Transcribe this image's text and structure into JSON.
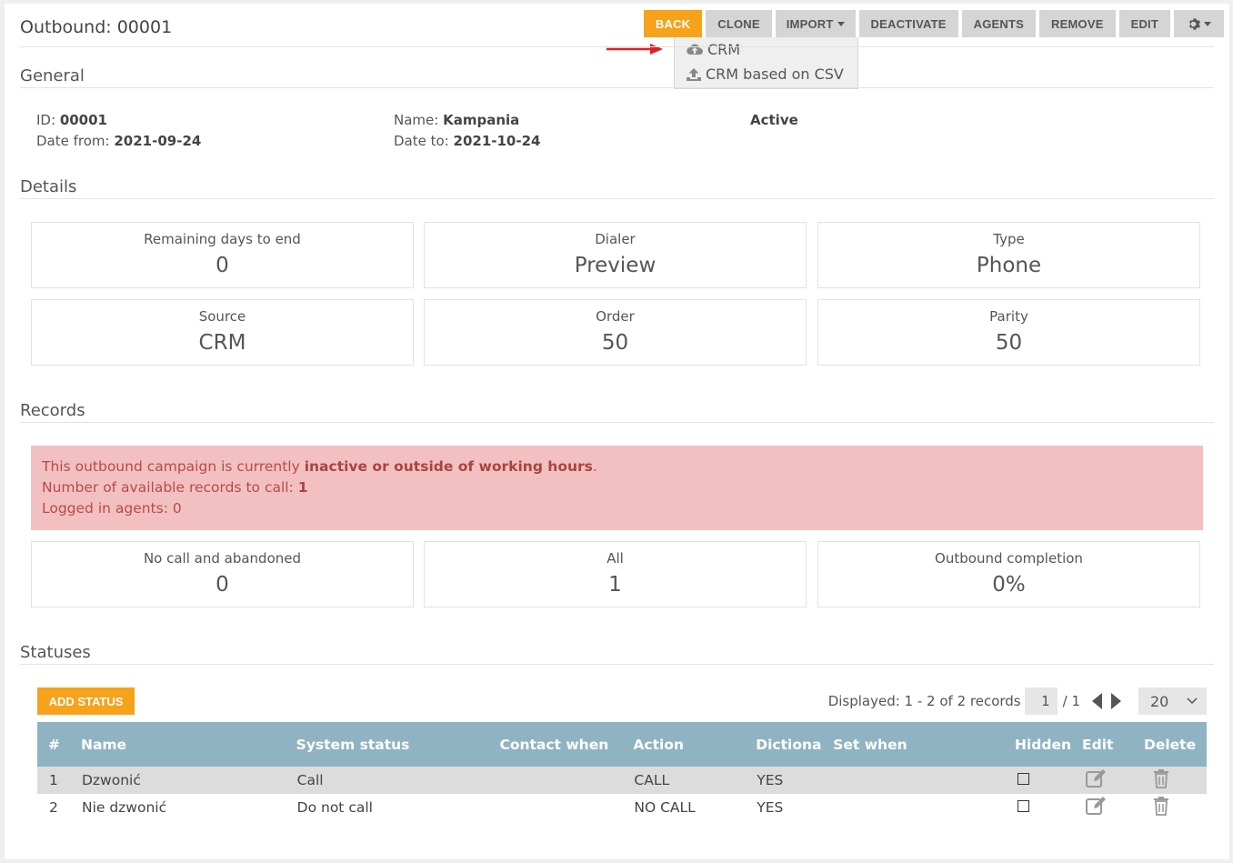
{
  "header": {
    "title": "Outbound: 00001"
  },
  "toolbar": {
    "back": "BACK",
    "clone": "CLONE",
    "import": "IMPORT",
    "deactivate": "DEACTIVATE",
    "agents": "AGENTS",
    "remove": "REMOVE",
    "edit": "EDIT"
  },
  "import_menu": {
    "crm": "CRM",
    "crm_csv": "CRM based on CSV"
  },
  "sections": {
    "general": "General",
    "details": "Details",
    "records": "Records",
    "statuses": "Statuses"
  },
  "general": {
    "id_label": "ID:",
    "id": "00001",
    "date_from_label": "Date from:",
    "date_from": "2021-09-24",
    "name_label": "Name:",
    "name": "Kampania",
    "date_to_label": "Date to:",
    "date_to": "2021-10-24",
    "state": "Active"
  },
  "details": [
    {
      "label": "Remaining days to end",
      "value": "0"
    },
    {
      "label": "Dialer",
      "value": "Preview"
    },
    {
      "label": "Type",
      "value": "Phone"
    },
    {
      "label": "Source",
      "value": "CRM"
    },
    {
      "label": "Order",
      "value": "50"
    },
    {
      "label": "Parity",
      "value": "50"
    }
  ],
  "alert": {
    "line1_pre": "This outbound campaign is currently ",
    "line1_bold": "inactive or outside of working hours",
    "line1_post": ".",
    "line2_pre": "Number of available records to call: ",
    "line2_bold": "1",
    "line3": "Logged in agents: 0"
  },
  "records": [
    {
      "label": "No call and abandoned",
      "value": "0"
    },
    {
      "label": "All",
      "value": "1"
    },
    {
      "label": "Outbound completion",
      "value": "0%"
    }
  ],
  "statuses": {
    "add_label": "ADD STATUS",
    "pager": {
      "displayed": "Displayed: 1 - 2 of 2 records",
      "page": "1",
      "of": "/ 1",
      "page_size": "20"
    },
    "columns": [
      "#",
      "Name",
      "System status",
      "Contact when",
      "Action",
      "Dictionary",
      "Set when",
      "Hidden",
      "Edit",
      "Delete"
    ],
    "rows": [
      {
        "num": "1",
        "name": "Dzwonić",
        "system": "Call",
        "contact": "",
        "action": "CALL",
        "dictionary": "YES",
        "set_when": ""
      },
      {
        "num": "2",
        "name": "Nie dzwonić",
        "system": "Do not call",
        "contact": "",
        "action": "NO CALL",
        "dictionary": "YES",
        "set_when": ""
      }
    ]
  },
  "colors": {
    "accent": "#f7a21b",
    "table_header": "#8fb3c3",
    "alert_bg": "#f2c0c0",
    "alert_text": "#b94a48"
  }
}
